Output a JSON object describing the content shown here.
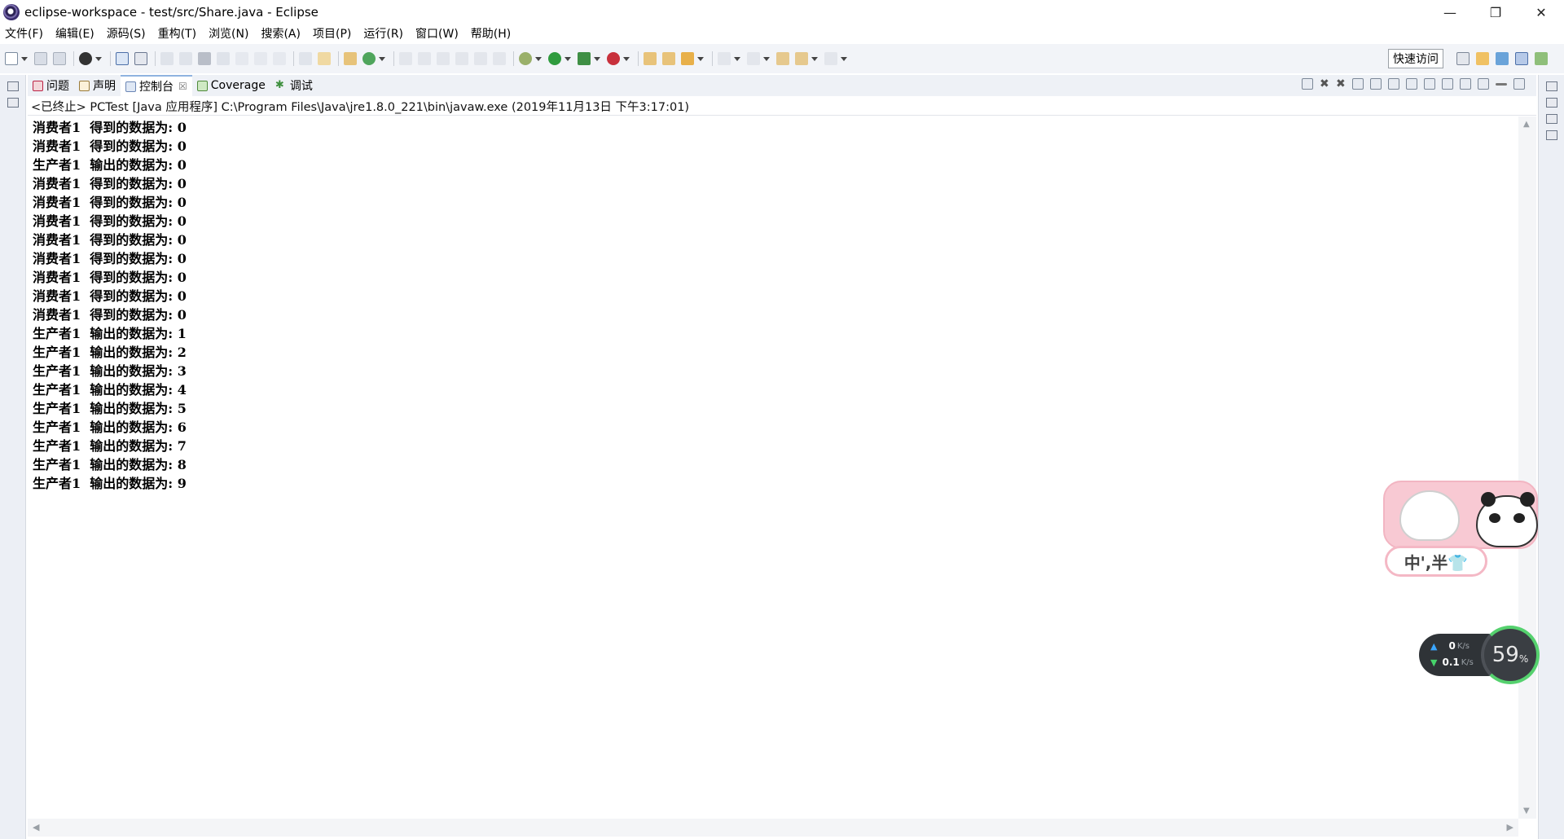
{
  "window": {
    "title": "eclipse-workspace - test/src/Share.java - Eclipse",
    "controls": [
      "—",
      "❐",
      "✕"
    ]
  },
  "menu": [
    "文件(F)",
    "编辑(E)",
    "源码(S)",
    "重构(T)",
    "浏览(N)",
    "搜索(A)",
    "项目(P)",
    "运行(R)",
    "窗口(W)",
    "帮助(H)"
  ],
  "toolbar": {
    "quick_access": "快速访问"
  },
  "tabs": [
    {
      "label": "问题",
      "icon": "problems-icon",
      "active": false
    },
    {
      "label": "声明",
      "icon": "declaration-icon",
      "active": false
    },
    {
      "label": "控制台",
      "icon": "console-icon",
      "active": true,
      "close": "☒"
    },
    {
      "label": "Coverage",
      "icon": "coverage-icon",
      "active": false
    },
    {
      "label": "调试",
      "icon": "debug-icon",
      "active": false
    }
  ],
  "console": {
    "header": "<已终止> PCTest [Java 应用程序] C:\\Program Files\\Java\\jre1.8.0_221\\bin\\javaw.exe  (2019年11月13日 下午3:17:01)",
    "lines": [
      "消费者1  得到的数据为: 0",
      "消费者1  得到的数据为: 0",
      "生产者1  输出的数据为: 0",
      "消费者1  得到的数据为: 0",
      "消费者1  得到的数据为: 0",
      "消费者1  得到的数据为: 0",
      "消费者1  得到的数据为: 0",
      "消费者1  得到的数据为: 0",
      "消费者1  得到的数据为: 0",
      "消费者1  得到的数据为: 0",
      "消费者1  得到的数据为: 0",
      "生产者1  输出的数据为: 1",
      "生产者1  输出的数据为: 2",
      "生产者1  输出的数据为: 3",
      "生产者1  输出的数据为: 4",
      "生产者1  输出的数据为: 5",
      "生产者1  输出的数据为: 6",
      "生产者1  输出的数据为: 7",
      "生产者1  输出的数据为: 8",
      "生产者1  输出的数据为: 9"
    ]
  },
  "ime": {
    "label": "中',半👕"
  },
  "net": {
    "up": "0",
    "up_unit": "K/s",
    "down": "0.1",
    "down_unit": "K/s",
    "cpu": "59",
    "cpu_unit": "%"
  }
}
